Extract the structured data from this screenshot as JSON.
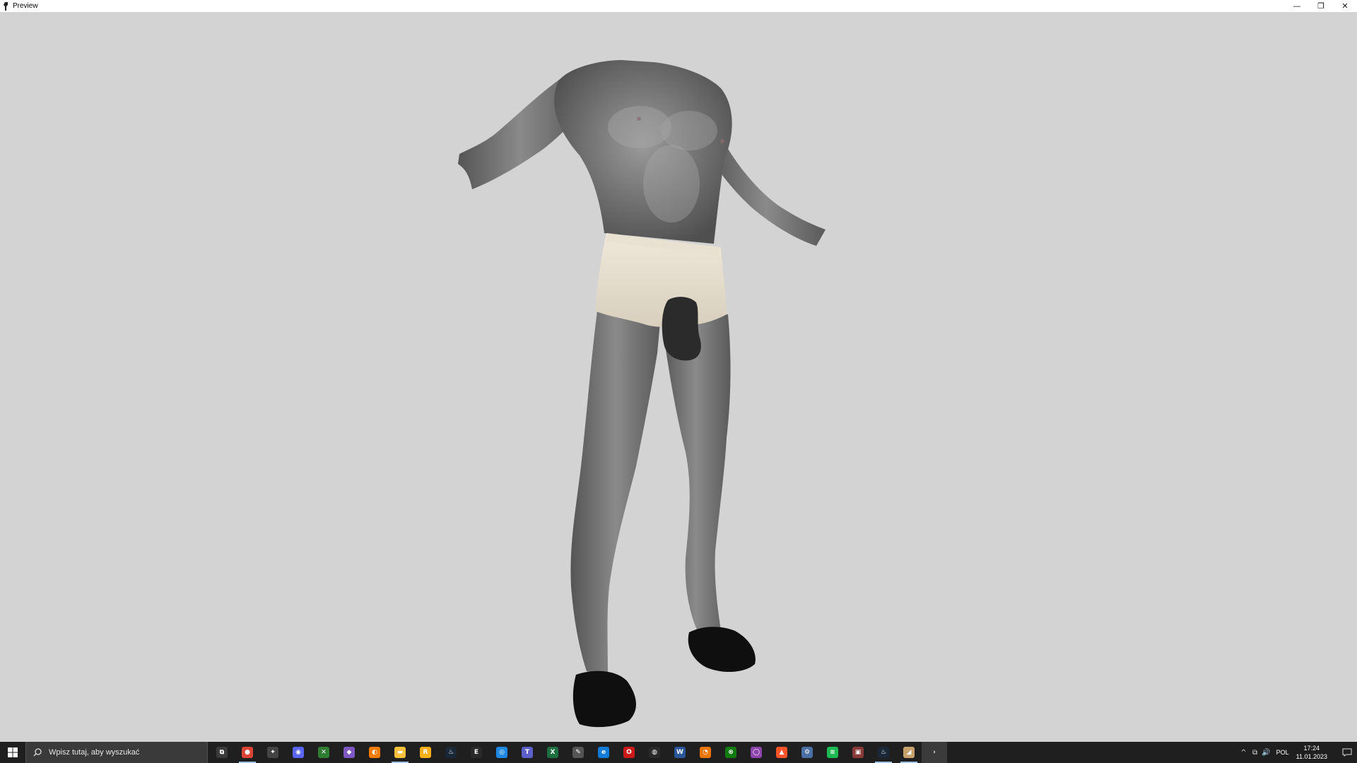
{
  "window": {
    "title": "Preview",
    "minimize_symbol": "—",
    "restore_symbol": "❐",
    "close_symbol": "✕"
  },
  "viewport": {
    "background_color": "#d3d3d3",
    "model": "headless male body mesh, grey skin texture, cream briefs, black hooves"
  },
  "taskbar": {
    "search_placeholder": "Wpisz tutaj, aby wyszukać",
    "apps": [
      {
        "name": "task-view-icon",
        "color": "#3a3a3a",
        "glyph": "⧉"
      },
      {
        "name": "chrome-icon",
        "color": "#db4437",
        "glyph": "●",
        "active": true
      },
      {
        "name": "game-icon",
        "color": "#444444",
        "glyph": "✦"
      },
      {
        "name": "discord-icon",
        "color": "#5865f2",
        "glyph": "◉"
      },
      {
        "name": "xbox-app-icon",
        "color": "#2e7d32",
        "glyph": "✕"
      },
      {
        "name": "gamepad-icon",
        "color": "#7e57c2",
        "glyph": "◆"
      },
      {
        "name": "origin-icon",
        "color": "#f57c00",
        "glyph": "◐"
      },
      {
        "name": "file-explorer-icon",
        "color": "#f9c13b",
        "glyph": "▬",
        "active": true
      },
      {
        "name": "rockstar-icon",
        "color": "#fcaf17",
        "glyph": "R"
      },
      {
        "name": "steam-icon",
        "color": "#1b2838",
        "glyph": "♨"
      },
      {
        "name": "epic-games-icon",
        "color": "#2a2a2a",
        "glyph": "E"
      },
      {
        "name": "uplay-icon",
        "color": "#1e88e5",
        "glyph": "◎"
      },
      {
        "name": "teams-icon",
        "color": "#5b5fc7",
        "glyph": "T"
      },
      {
        "name": "excel-icon",
        "color": "#1d6f42",
        "glyph": "X"
      },
      {
        "name": "notepad-icon",
        "color": "#555555",
        "glyph": "✎"
      },
      {
        "name": "edge-icon",
        "color": "#0f7cd8",
        "glyph": "e"
      },
      {
        "name": "opera-icon",
        "color": "#cc1a1a",
        "glyph": "O"
      },
      {
        "name": "obs-icon",
        "color": "#2a2a2a",
        "glyph": "◍"
      },
      {
        "name": "word-icon",
        "color": "#2b579a",
        "glyph": "W"
      },
      {
        "name": "blender-icon",
        "color": "#ea7600",
        "glyph": "◔"
      },
      {
        "name": "xbox-icon",
        "color": "#107c10",
        "glyph": "⊗"
      },
      {
        "name": "twitch-icon",
        "color": "#8e44ad",
        "glyph": "◯"
      },
      {
        "name": "brave-icon",
        "color": "#fb542b",
        "glyph": "▲"
      },
      {
        "name": "tool-icon",
        "color": "#4a6fa5",
        "glyph": "⚙"
      },
      {
        "name": "spotify-icon",
        "color": "#1db954",
        "glyph": "≋"
      },
      {
        "name": "game-thumbnail-icon",
        "color": "#8b3a3a",
        "glyph": "▣"
      },
      {
        "name": "steam-active-icon",
        "color": "#1b2838",
        "glyph": "♨",
        "active": true
      },
      {
        "name": "preview-app-icon",
        "color": "#c8a26b",
        "glyph": "◢",
        "active": true
      },
      {
        "name": "terminal-icon",
        "color": "#3b3b3b",
        "glyph": "›",
        "highlight": true
      }
    ],
    "tray": {
      "chevron": "^",
      "network": "⧉",
      "volume": "🔊",
      "language": "POL",
      "time": "17:24",
      "date": "11.01.2023",
      "notifications": "▭"
    }
  }
}
